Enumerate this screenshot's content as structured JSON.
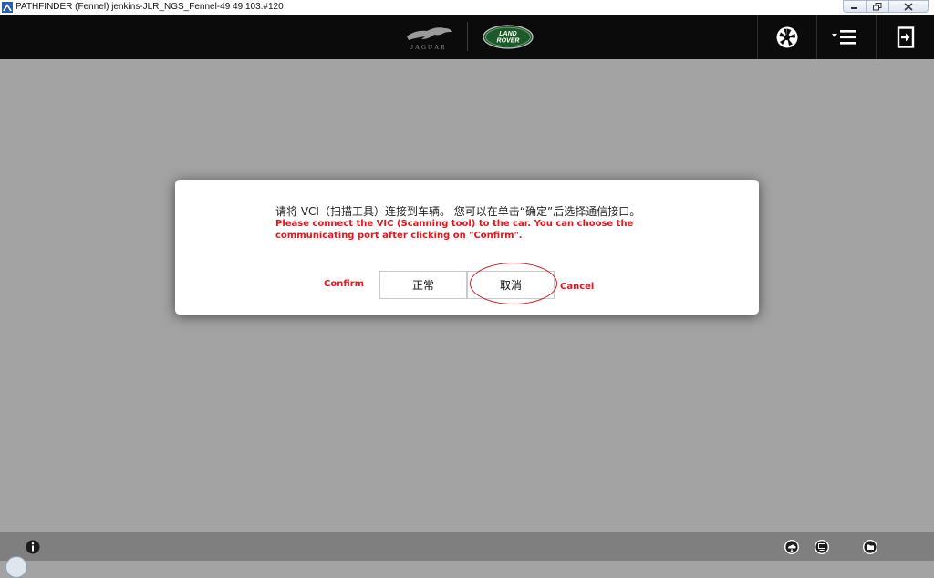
{
  "window": {
    "title": "PATHFINDER (Fennel) jenkins-JLR_NGS_Fennel-49 49 103.#120",
    "controls": [
      "minimize-icon",
      "restore-icon",
      "close-icon"
    ]
  },
  "header": {
    "brands": {
      "jaguar_text": "JAGUAR",
      "landrover_line1": "LAND",
      "landrover_line2": "ROVER"
    },
    "toolbar_icons": [
      "camera-shutter-icon",
      "menu-icon",
      "exit-icon"
    ]
  },
  "dialog": {
    "message_cn": "请将 VCI（扫描工具）连接到车辆。 您可以在单击“确定”后选择通信接口。",
    "message_en": "Please connect the VIC (Scanning tool) to the car. You can choose the communicating port after clicking on \"Confirm\".",
    "confirm_annotation": "Confirm",
    "cancel_annotation": "Cancel",
    "ok_button": "正常",
    "cancel_button": "取消"
  },
  "footer": {
    "icons": [
      "info-icon",
      "cloud-sync-icon",
      "monitor-icon",
      "folder-icon"
    ]
  },
  "colors": {
    "topbar": "#0b0b0c",
    "background": "#a3a3a3",
    "annotation_red": "#e8141b",
    "landrover_green": "#1d5a2a",
    "footer": "#7f7f7f"
  }
}
